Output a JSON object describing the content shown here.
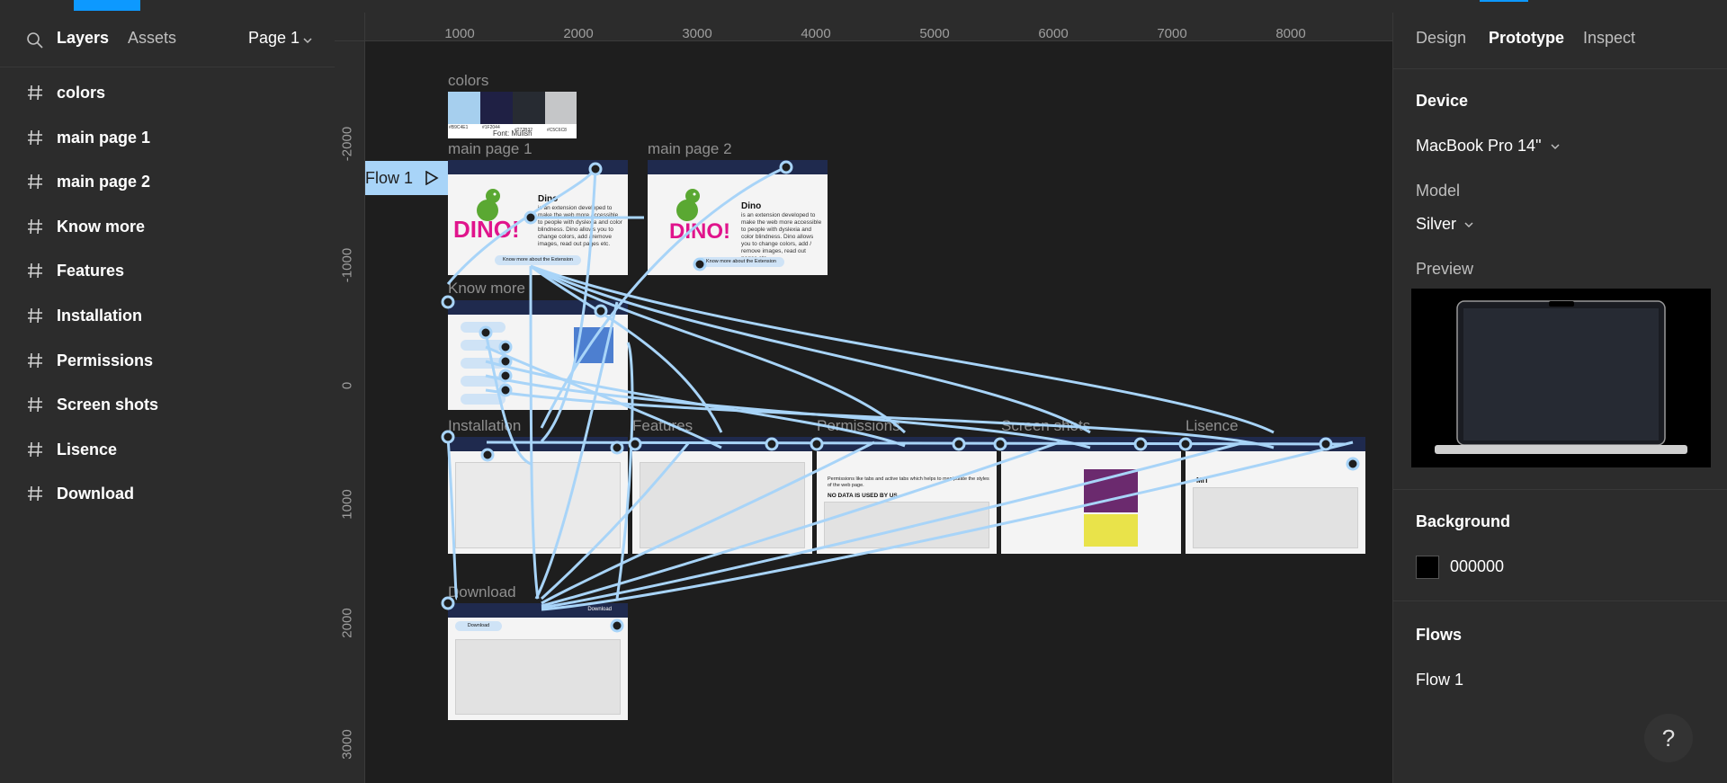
{
  "left_panel": {
    "tab_layers": "Layers",
    "tab_assets": "Assets",
    "page_selector": "Page 1",
    "layers": [
      {
        "label": "colors"
      },
      {
        "label": "main page 1"
      },
      {
        "label": "main page 2"
      },
      {
        "label": "Know more"
      },
      {
        "label": "Features"
      },
      {
        "label": "Installation"
      },
      {
        "label": "Permissions"
      },
      {
        "label": "Screen shots"
      },
      {
        "label": "Lisence"
      },
      {
        "label": "Download"
      }
    ]
  },
  "rulers": {
    "top": [
      "1000",
      "2000",
      "3000",
      "4000",
      "5000",
      "6000",
      "7000",
      "8000"
    ],
    "left": [
      "-2000",
      "-1000",
      "0",
      "1000",
      "2000",
      "3000"
    ]
  },
  "canvas": {
    "flow_badge": "Flow 1",
    "frames": {
      "colors": "colors",
      "main1": "main page 1",
      "main2": "main page 2",
      "know": "Know more",
      "install": "Installation",
      "features": "Features",
      "perm": "Permissions",
      "shots": "Screen shots",
      "lis": "Lisence",
      "download": "Download"
    },
    "color_codes": [
      "#B9C4E1",
      "#1F2044",
      "#272B32",
      "#C5C6C8"
    ],
    "font_note": "Font: Mulish",
    "dino_word": "DINO!",
    "dino_text1": "Dino",
    "dino_text2": "is an extension developed to make the web more accessible to people with dyslexia and color blindness. Dino allows you to change colors, add / remove images, read out pages etc.",
    "know_more_btn": "Know more about the Extension",
    "know_more_btn2": "Know more about the Extension",
    "download_hdr": "Download",
    "perm_no_data": "NO DATA IS USED BY US.",
    "perm_text": "Permissions like tabs and active tabs which helps to manipulate the styles of the web page.",
    "mit": "MIT",
    "dl_btn": "Download"
  },
  "right_panel": {
    "tabs": [
      "Design",
      "Prototype",
      "Inspect"
    ],
    "device_title": "Device",
    "device_value": "MacBook Pro 14\"",
    "model_label": "Model",
    "model_value": "Silver",
    "preview_label": "Preview",
    "background_title": "Background",
    "background_value": "000000",
    "flows_title": "Flows",
    "flow_item": "Flow 1"
  },
  "help_label": "?",
  "colors": {
    "accent": "#0d99ff",
    "connector": "#a8d4f8",
    "panel": "#2c2c2c",
    "canvas": "#1e1e1e",
    "frame_header": "#1f2a4e",
    "dino_pink": "#e0148c"
  }
}
